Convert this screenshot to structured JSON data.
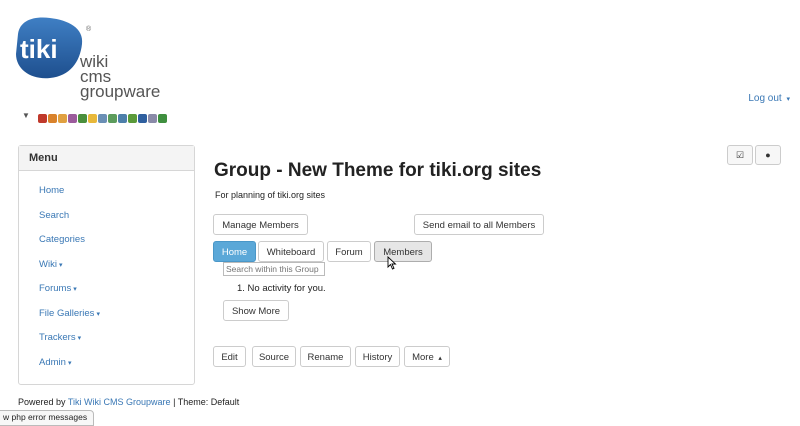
{
  "logo": {
    "badge_text": "tiki",
    "reg_mark": "®",
    "line1": "wiki",
    "line2": "cms",
    "line3": "groupware"
  },
  "header": {
    "logout_label": "Log out"
  },
  "toolbar": {
    "icons": [
      "hammer-icon",
      "home-icon",
      "pencil-icon",
      "user-icon",
      "users-icon",
      "key-icon",
      "grid-icon",
      "calendar-icon",
      "table-icon",
      "puzzle-icon",
      "book-icon",
      "card-icon",
      "leaf-icon"
    ],
    "colors": [
      "#c0392b",
      "#d9822b",
      "#e0a040",
      "#9c5b9c",
      "#4a8f3c",
      "#e8b83a",
      "#6a8fb5",
      "#5c9c5c",
      "#4d7faa",
      "#5a9a3a",
      "#2f5f9f",
      "#8a8aa8",
      "#3f8f3f"
    ]
  },
  "sidebar": {
    "title": "Menu",
    "items": [
      {
        "label": "Home",
        "caret": false
      },
      {
        "label": "Search",
        "caret": false
      },
      {
        "label": "Categories",
        "caret": false
      },
      {
        "label": "Wiki",
        "caret": true
      },
      {
        "label": "Forums",
        "caret": true
      },
      {
        "label": "File Galleries",
        "caret": true
      },
      {
        "label": "Trackers",
        "caret": true
      },
      {
        "label": "Admin",
        "caret": true
      }
    ]
  },
  "page": {
    "title": "Group - New Theme for tiki.org sites",
    "description": "For planning of tiki.org sites",
    "manage_members_label": "Manage Members",
    "send_email_label": "Send email to all Members",
    "tabs": [
      "Home",
      "Whiteboard",
      "Forum",
      "Members"
    ],
    "search_placeholder": "Search within this Group",
    "activity_item": "1.  No activity for you.",
    "show_more_label": "Show More",
    "actions": [
      "Edit",
      "Source",
      "Rename",
      "History",
      "More"
    ]
  },
  "footer": {
    "powered_prefix": "Powered by ",
    "powered_link": "Tiki Wiki CMS Groupware",
    "theme_text": " | Theme: Default",
    "php_errors_label": "w php error messages"
  },
  "colors": {
    "accent": "#5ba8d8",
    "link": "#3a78b5",
    "logo_blue": "#2a63a8"
  }
}
